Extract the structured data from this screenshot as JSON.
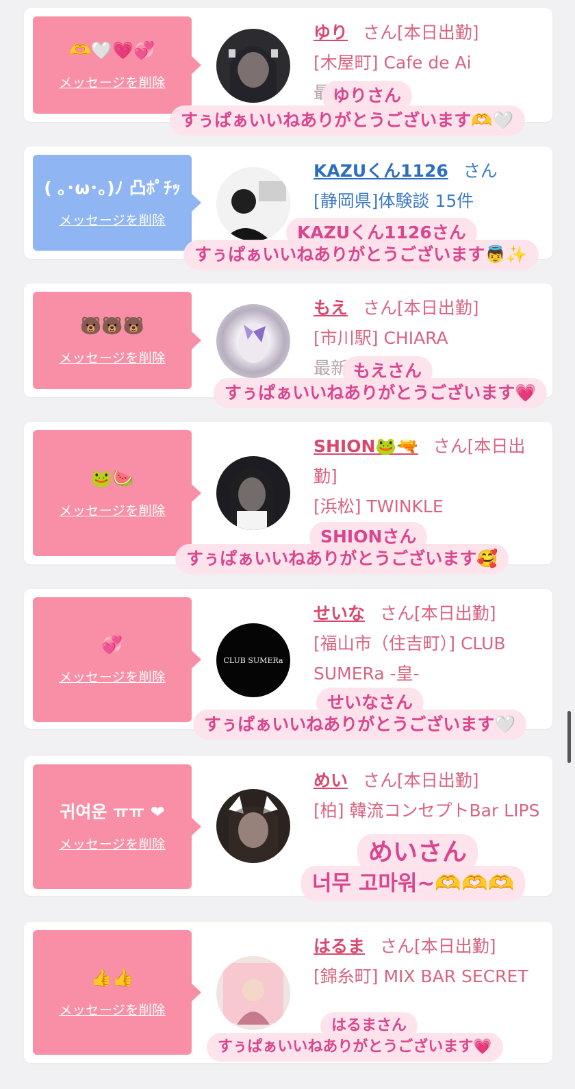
{
  "common": {
    "delete_label": "メッセージを削除",
    "san": "さん"
  },
  "cards": [
    {
      "message": "🫶🤍💗💞",
      "name": "ゆり",
      "suffix": "さん[本日出勤]",
      "shop": "[木屋町] Cafe de Ai",
      "shop2": "",
      "faded": "最新",
      "caption_name": "ゆりさん",
      "caption_text": "すぅぱぁいいねありがとうございます🫶🤍"
    },
    {
      "message": "( ｡･ω･｡)ﾉ 凸ﾎﾟﾁｯ",
      "name": "KAZUくん1126",
      "suffix": "さん",
      "shop": "[静岡県]体験談 15件",
      "shop2": "",
      "faded": "",
      "caption_name": "KAZUくん1126さん",
      "caption_text": "すぅぱぁいいねありがとうございます👼✨"
    },
    {
      "message": "🐻🐻🐻",
      "name": "もえ",
      "suffix": "さん[本日出勤]",
      "shop": "[市川駅] CHIARA",
      "shop2": "",
      "faded": "最新",
      "caption_name": "もえさん",
      "caption_text": "すぅぱぁいいねありがとうございます💗"
    },
    {
      "message": "🐸🍉",
      "name": "SHION🐸🔫",
      "suffix": "さん[本日出勤]",
      "shop": "[浜松] TWINKLE",
      "shop2": "",
      "faded": "",
      "caption_name": "SHIONさん",
      "caption_text": "すぅぱぁいいねありがとうございます🥰"
    },
    {
      "message": "💞",
      "name": "せいな",
      "suffix": "さん[本日出勤]",
      "shop": "[福山市（住吉町）] CLUB SUMERa -皇-",
      "shop2": "",
      "faded": "",
      "caption_name": "せいなさん",
      "caption_text": "すぅぱぁいいねありがとうございます🤍",
      "avatar_text": "CLUB SUMERa"
    },
    {
      "message": "귀여운 ㅠㅠ ❤",
      "name": "めい",
      "suffix": "さん[本日出勤]",
      "shop": "[柏] 韓流コンセプトBar LIPS",
      "shop2": "",
      "faded": "",
      "caption_name": "めいさん",
      "caption_text": "너무 고마워~🫶🫶🫶"
    },
    {
      "message": "👍👍",
      "name": "はるま",
      "suffix": "さん[本日出勤]",
      "shop": "[錦糸町] MIX BAR SECRET",
      "shop2": "",
      "faded": "",
      "caption_name": "はるまさん",
      "caption_text": "すぅぱぁいいねありがとうございます💗"
    }
  ],
  "colors": {
    "bubble_pink": "#f98fa6",
    "bubble_blue": "#8fb6f3",
    "name_pink": "#d9476c",
    "name_blue": "#2d6ec0",
    "caption_text": "#d9468f",
    "caption_bg": "#fde2ea"
  }
}
